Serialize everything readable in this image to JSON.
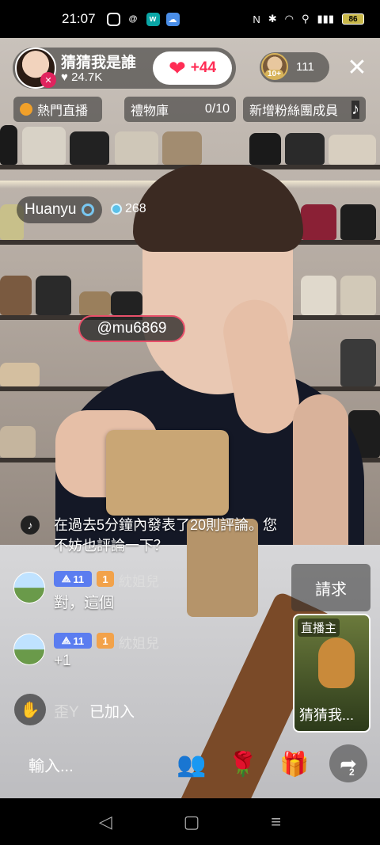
{
  "status_bar": {
    "time": "21:07",
    "battery": "86"
  },
  "host": {
    "name": "猜猜我是誰",
    "likes": "24.7K",
    "follow_count": "+44"
  },
  "viewers": {
    "avatar_rank": "10+",
    "count": "111"
  },
  "chips": [
    {
      "label": "熱門直播"
    },
    {
      "label": "禮物庫",
      "count": "0/10"
    },
    {
      "label": "新增粉絲團成員"
    }
  ],
  "name_tag": {
    "name": "Huanyu",
    "gems": "268"
  },
  "mention": "@mu6869",
  "system_comment": "在過去5分鐘內發表了20則評論。您不妨也評論一下？",
  "comments": [
    {
      "level": "11",
      "fan_level": "1",
      "fan_club": "紞姐兒",
      "text": "對，這個"
    },
    {
      "level": "11",
      "fan_level": "1",
      "fan_club": "紞姐兒",
      "text": "+1"
    }
  ],
  "joined": {
    "user": "歪Y",
    "text": "已加入"
  },
  "request_button": "請求",
  "host_card": {
    "tag": "直播主",
    "name": "猜猜我..."
  },
  "input_placeholder": "輸入...",
  "share_count": "2",
  "colors": {
    "accent": "#ff2d55",
    "level_badge": "#5b7df0",
    "fan_badge": "#f2a24a",
    "mention_border": "#e8506a"
  }
}
